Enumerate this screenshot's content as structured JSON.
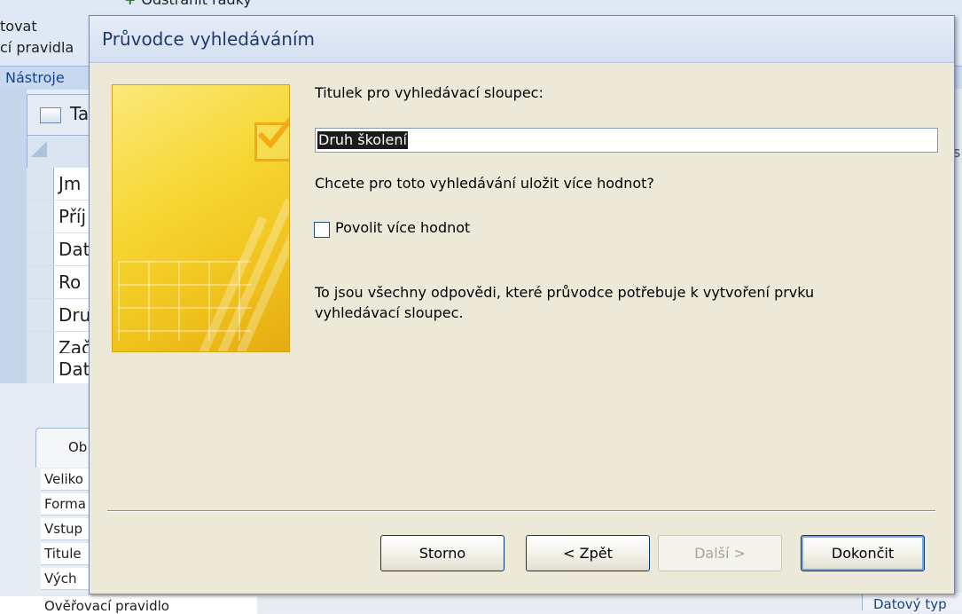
{
  "background": {
    "ribbon_top_text": "Odstranit řádky",
    "ribbon_left_line1": "tovat",
    "ribbon_left_line2": "cí pravidla",
    "group_label": "Nástroje",
    "table_tab_label": "Ta",
    "field_rows": [
      "Jm",
      "Příj",
      "Dat",
      "Ro",
      "Dru",
      "Zač",
      "Dat"
    ],
    "properties_tab_label": "Ob",
    "property_rows": [
      "Veliko",
      "Forma",
      "Vstup",
      "Titule",
      "Vých"
    ],
    "bottom_row_label": "Ověřovací pravidlo",
    "right_edge_text": "s",
    "right_bottom_label": "Datový typ"
  },
  "dialog": {
    "title": "Průvodce vyhledáváním",
    "caption_label": "Titulek pro vyhledávací sloupec:",
    "caption_value": "Druh školení",
    "multi_value_question": "Chcete pro toto vyhledávání uložit více hodnot?",
    "allow_multiple_label": "Povolit více hodnot",
    "allow_multiple_checked": false,
    "info_line1": "To jsou všechny odpovědi, které průvodce potřebuje k vytvoření prvku",
    "info_line2": "vyhledávací sloupec.",
    "buttons": {
      "cancel": "Storno",
      "back": "< Zpět",
      "next": "Další >",
      "finish": "Dokončit"
    }
  },
  "colors": {
    "dialog_bg": "#ece9d8",
    "title_text": "#1f3a6a",
    "illustration_yellow": "#f7d734"
  }
}
